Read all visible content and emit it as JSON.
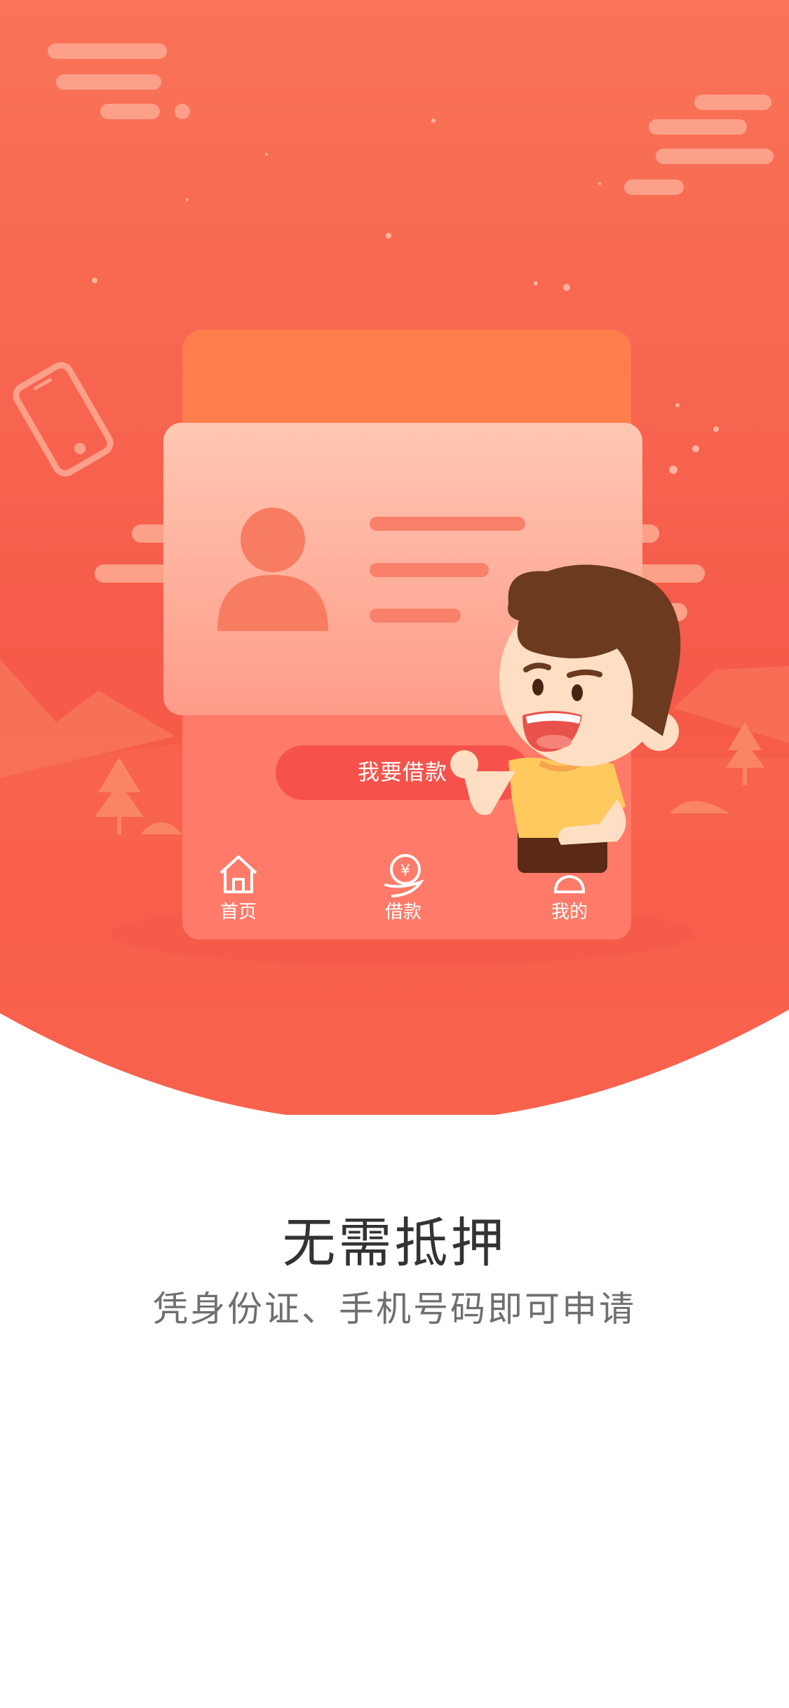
{
  "illustration": {
    "cta_label": "我要借款",
    "nav": [
      {
        "label": "首页",
        "icon": "home-icon"
      },
      {
        "label": "借款",
        "icon": "yen-coin-hand-icon"
      },
      {
        "label": "我的",
        "icon": "profile-icon"
      }
    ]
  },
  "intro": {
    "title": "无需抵押",
    "subtitle": "凭身份证、手机号码即可申请"
  },
  "colors": {
    "hero_top": "#F97458",
    "hero_bottom": "#F65E4C",
    "card_orange": "#FF7E4B",
    "cta_red": "#F6524B",
    "title_text": "#333333",
    "subtitle_text": "#6f6f6f"
  }
}
